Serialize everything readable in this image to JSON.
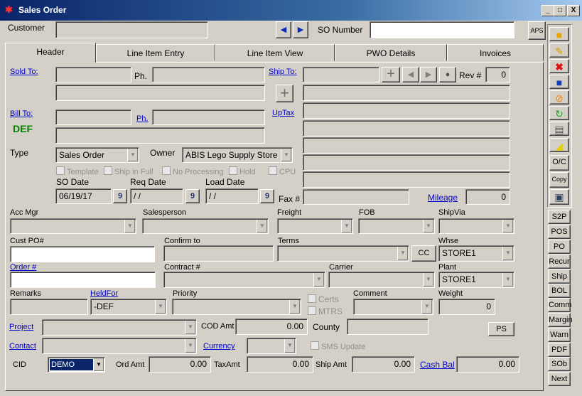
{
  "window": {
    "title": "Sales Order",
    "controls": [
      "_",
      "□",
      "X"
    ]
  },
  "top": {
    "customer_label": "Customer",
    "so_number_label": "SO Number",
    "aps_label": "APS",
    "nav_prev": "◀",
    "nav_next": "▶"
  },
  "tabs": [
    "Header",
    "Line Item Entry",
    "Line Item View",
    "PWO Details",
    "Invoices"
  ],
  "header": {
    "sold_to": "Sold To:",
    "ph": "Ph.",
    "ship_to": "Ship To:",
    "rev_label": "Rev #",
    "rev_value": "0",
    "bill_to": "Bill To:",
    "bill_ph": "Ph.",
    "uptax": "UpTax",
    "def": "DEF",
    "type_label": "Type",
    "type_value": "Sales Order",
    "owner_label": "Owner",
    "owner_value": "ABIS Lego Supply Store",
    "checks": [
      "Template",
      "Ship in Full",
      "No Processing",
      "Hold",
      "CPU"
    ],
    "so_date_label": "SO Date",
    "so_date": "06/19/17",
    "req_date_label": "Req Date",
    "req_date": "/ /",
    "load_date_label": "Load Date",
    "load_date": "/ /",
    "cal": "9",
    "fax_label": "Fax #",
    "mileage_label": "Mileage",
    "mileage_value": "0",
    "acc_mgr": "Acc Mgr",
    "salesperson": "Salesperson",
    "freight": "Freight",
    "fob": "FOB",
    "shipvia": "ShipVia",
    "cust_po": "Cust PO#",
    "confirm_to": "Confirm to",
    "terms": "Terms",
    "cc": "CC",
    "whse_label": "Whse",
    "whse_value": "STORE1",
    "order_no": "Order #",
    "contract_no": "Contract #",
    "carrier": "Carrier",
    "plant_label": "Plant",
    "plant_value": "STORE1",
    "remarks": "Remarks",
    "held_for": "HeldFor",
    "held_value": "-DEF",
    "priority": "Priority",
    "certs": "Certs",
    "mtrs": "MTRS",
    "comment": "Comment",
    "weight_label": "Weight",
    "weight_value": "0",
    "project": "Project",
    "cod_amt": "COD Amt",
    "cod_value": "0.00",
    "county": "County",
    "ps": "PS",
    "contact": "Contact",
    "currency": "Currency",
    "sms_update": "SMS Update",
    "cid": "CID",
    "cid_value": "DEMO",
    "ord_amt": "Ord Amt",
    "ord_value": "0.00",
    "tax_amt": "TaxAmt",
    "tax_value": "0.00",
    "ship_amt": "Ship Amt",
    "ship_value": "0.00",
    "cash_bal": "Cash Bal",
    "cash_value": "0.00"
  },
  "side_buttons": [
    "O/C",
    "Copy",
    "S2P",
    "POS",
    "PO",
    "Recur",
    "Ship",
    "BOL",
    "Comm",
    "Margin",
    "Warn",
    "PDF",
    "SOb",
    "Next"
  ]
}
